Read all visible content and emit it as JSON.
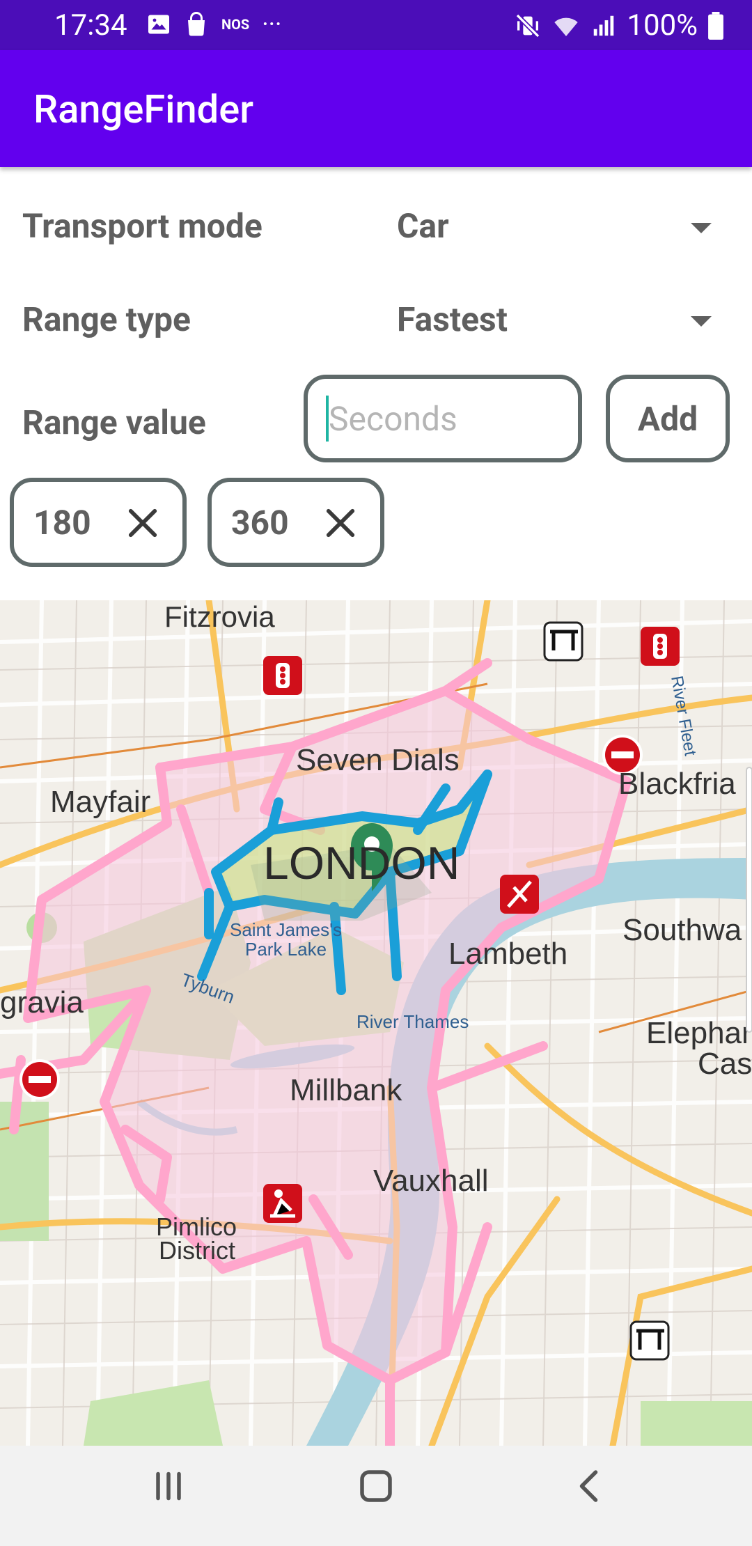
{
  "status_bar": {
    "time": "17:34",
    "left_icons": [
      "image-icon",
      "shopping-bag-icon",
      "nos-icon",
      "more-dots-icon"
    ],
    "nos_label": "NOS",
    "more_label": "···",
    "battery": "100%",
    "right_icons": [
      "mute-vibrate-icon",
      "wifi-icon",
      "signal-icon",
      "battery-icon"
    ]
  },
  "app_bar": {
    "title": "RangeFinder",
    "color": "#6200EE"
  },
  "form": {
    "transport_mode_label": "Transport mode",
    "transport_mode_value": "Car",
    "range_type_label": "Range type",
    "range_type_value": "Fastest",
    "range_value_label": "Range value",
    "range_input_placeholder": "Seconds",
    "range_input_value": "",
    "add_label": "Add"
  },
  "chips": [
    {
      "label": "180"
    },
    {
      "label": "360"
    }
  ],
  "map": {
    "labels": {
      "fitzrovia": "Fitzrovia",
      "seven_dials": "Seven Dials",
      "mayfair": "Mayfair",
      "blackfriars": "Blackfria",
      "london": "LONDON",
      "saint_james_1": "Saint James's",
      "saint_james_2": "Park Lake",
      "lambeth": "Lambeth",
      "southwark": "Southwa",
      "belgravia": "gravia",
      "tyburn": "Tyburn",
      "river_thames": "River Thames",
      "elephant_1": "Elephar",
      "elephant_2": "Cas",
      "millbank": "Millbank",
      "vauxhall": "Vauxhall",
      "pimlico_1": "Pimlico",
      "pimlico_2": "District",
      "river_fleet": "River Fleet"
    },
    "range_colors": {
      "range_360": "#ffa6cc",
      "range_180": "#1a9fd8"
    },
    "marker_color": "#2e8b57"
  },
  "nav_bar": {
    "buttons": [
      "recent-apps-icon",
      "home-icon",
      "back-icon"
    ]
  }
}
